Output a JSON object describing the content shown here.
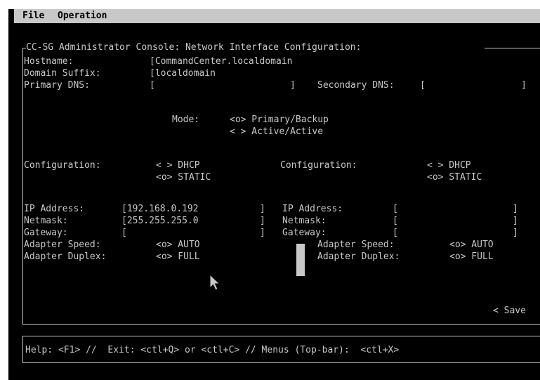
{
  "menubar": {
    "file": "File",
    "operation": "Operation"
  },
  "title": "CC-SG Administrator Console: Network Interface Configuration:",
  "hostname": {
    "label": "Hostname:",
    "value": "[CommandCenter.localdomain"
  },
  "domain": {
    "label": "Domain Suffix:",
    "value": "[localdomain"
  },
  "dns": {
    "primary_label": "Primary DNS:",
    "primary_open": "[",
    "primary_close": "]",
    "secondary_label": "Secondary DNS:",
    "secondary_open": "[",
    "secondary_close": "]"
  },
  "mode": {
    "label": "Mode:",
    "primary_backup": "<o> Primary/Backup",
    "active_active": "< > Active/Active"
  },
  "left": {
    "config_label": "Configuration:",
    "dhcp": "< > DHCP",
    "static": "<o> STATIC",
    "ip_label": "IP Address:",
    "ip_value": "[192.168.0.192",
    "ip_close": "]",
    "netmask_label": "Netmask:",
    "netmask_value": "[255.255.255.0",
    "netmask_close": "]",
    "gateway_label": "Gateway:",
    "gateway_value": "[",
    "gateway_close": "]",
    "speed_label": "Adapter Speed:",
    "speed_value": "<o> AUTO",
    "duplex_label": "Adapter Duplex:",
    "duplex_value": "<o> FULL"
  },
  "right": {
    "config_label": "Configuration:",
    "dhcp": "< > DHCP",
    "static": "<o> STATIC",
    "ip_label": "IP Address:",
    "ip_value": "[",
    "ip_close": "]",
    "netmask_label": "Netmask:",
    "netmask_value": "[",
    "netmask_close": "]",
    "gateway_label": "Gateway:",
    "gateway_value": "[",
    "gateway_close": "]",
    "speed_label": "Adapter Speed:",
    "speed_value": "<o> AUTO",
    "duplex_label": "Adapter Duplex:",
    "duplex_value": "<o> FULL"
  },
  "save": "< Save",
  "help": "Help: <F1> //  Exit: <ctl+Q> or <ctl+C> // Menus (Top-bar):  <ctl+X>",
  "icons": {
    "pointer": "mouse-pointer-icon"
  }
}
